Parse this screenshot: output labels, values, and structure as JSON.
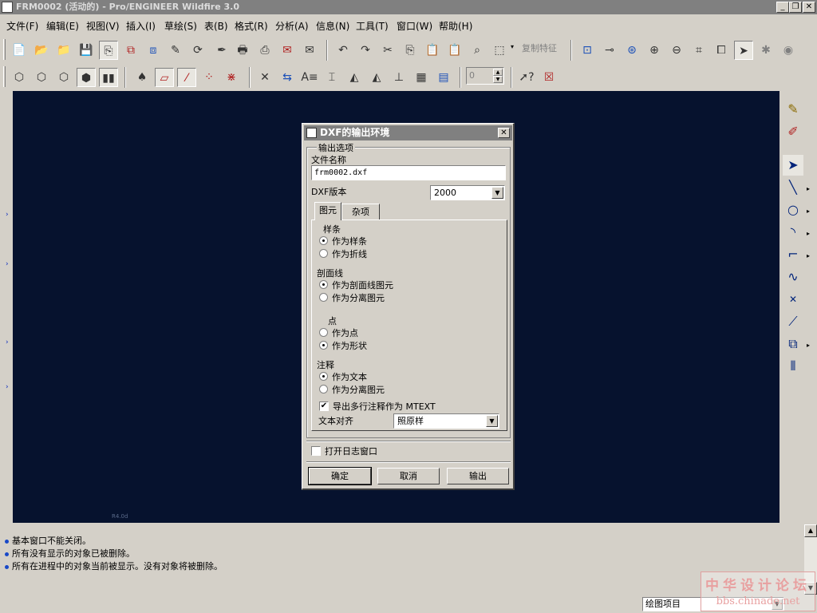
{
  "window": {
    "title": "FRM0002 (活动的) - Pro/ENGINEER Wildfire 3.0"
  },
  "menu": [
    "文件(F)",
    "编辑(E)",
    "视图(V)",
    "插入(I)",
    "草绘(S)",
    "表(B)",
    "格式(R)",
    "分析(A)",
    "信息(N)",
    "工具(T)",
    "窗口(W)",
    "帮助(H)"
  ],
  "toolbar": {
    "copy_feature_label": "复制特征",
    "spinner_value": "0"
  },
  "canvas": {
    "corner_text": "R4.0d"
  },
  "dialog": {
    "title": "DXF的输出环境",
    "output_group": "输出选项",
    "filename_label": "文件名称",
    "filename_value": "frm0002.dxf",
    "version_label": "DXF版本",
    "version_value": "2000",
    "tabs": [
      "图元",
      "杂项"
    ],
    "spline_label": "样条",
    "spline_opt1": "作为样条",
    "spline_opt2": "作为折线",
    "hatch_label": "剖面线",
    "hatch_opt1": "作为剖面线图元",
    "hatch_opt2": "作为分离图元",
    "point_label": "点",
    "point_opt1": "作为点",
    "point_opt2": "作为形状",
    "note_label": "注释",
    "note_opt1": "作为文本",
    "note_opt2": "作为分离图元",
    "mtext_label": "导出多行注释作为 MTEXT",
    "text_align_label": "文本对齐",
    "text_align_value": "照原样",
    "log_label": "打开日志窗口",
    "ok": "确定",
    "cancel": "取消",
    "export": "输出"
  },
  "messages": [
    "基本窗口不能关闭。",
    "所有没有显示的对象已被删除。",
    "所有在进程中的对象当前被显示。没有对象将被删除。"
  ],
  "status": {
    "filter_value": "绘图项目"
  },
  "watermark": {
    "line1": "中华设计论坛",
    "line2": "bbs.chinade.net"
  }
}
